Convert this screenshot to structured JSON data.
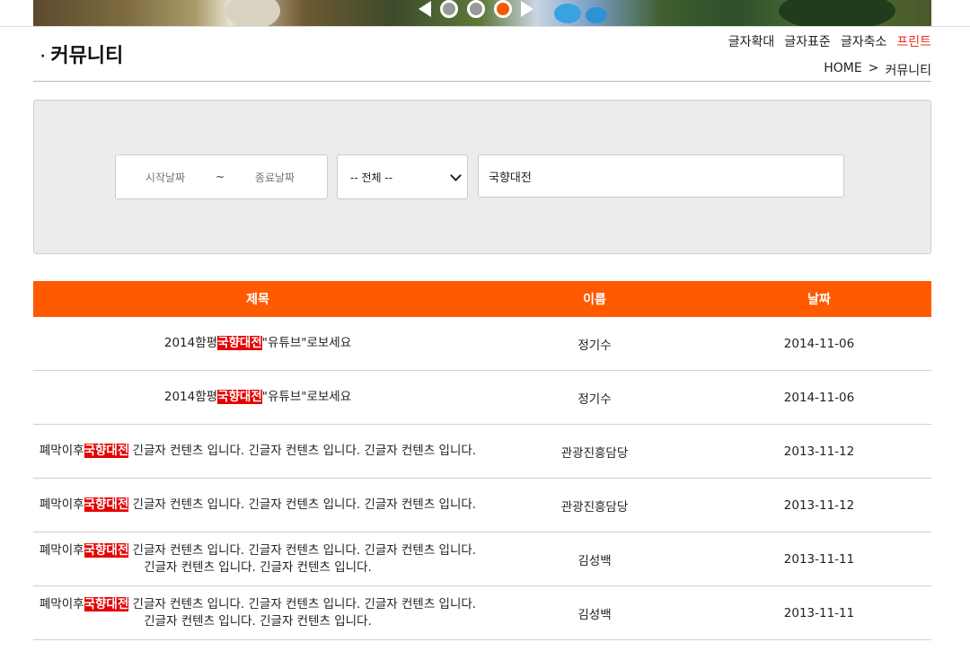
{
  "banner": {
    "slider": {
      "prev": "previous-slide",
      "next": "next-slide",
      "dots": 3,
      "active_dot": 3
    }
  },
  "header": {
    "title": "커뮤니티",
    "bullet": "·",
    "font_tools": {
      "enlarge": "글자확대",
      "normal": "글자표준",
      "shrink": "글자축소",
      "print": "프린트"
    },
    "breadcrumb": {
      "home": "HOME",
      "sep": ">",
      "current": "커뮤니티"
    }
  },
  "search": {
    "start_placeholder": "시작날짜",
    "tilde": "~",
    "end_placeholder": "종료날짜",
    "category_value": "-- 전체 --",
    "keyword_value": "국향대전"
  },
  "table": {
    "headers": {
      "title": "제목",
      "name": "이름",
      "date": "날짜"
    },
    "rows": [
      {
        "pre": "2014함평",
        "hl": "국향대전",
        "post": "\"유튜브\"로보세요",
        "name": "정기수",
        "date": "2014-11-06"
      },
      {
        "pre": "2014함평",
        "hl": "국향대전",
        "post": "\"유튜브\"로보세요",
        "name": "정기수",
        "date": "2014-11-06"
      },
      {
        "pre": "폐막이후",
        "hl": "국향대전",
        "post": " 긴글자 컨텐츠 입니다. 긴글자 컨텐츠 입니다. 긴글자 컨텐츠 입니다.",
        "name": "관광진흥담당",
        "date": "2013-11-12"
      },
      {
        "pre": "폐막이후",
        "hl": "국향대전",
        "post": " 긴글자 컨텐츠 입니다. 긴글자 컨텐츠 입니다. 긴글자 컨텐츠 입니다.",
        "name": "관광진흥담당",
        "date": "2013-11-12"
      },
      {
        "pre": "폐막이후",
        "hl": "국향대전",
        "post": " 긴글자 컨텐츠 입니다. 긴글자 컨텐츠 입니다. 긴글자 컨텐츠 입니다. 긴글자 컨텐츠 입니다. 긴글자 컨텐츠 입니다.",
        "name": "김성백",
        "date": "2013-11-11"
      },
      {
        "pre": "폐막이후",
        "hl": "국향대전",
        "post": " 긴글자 컨텐츠 입니다. 긴글자 컨텐츠 입니다. 긴글자 컨텐츠 입니다. 긴글자 컨텐츠 입니다. 긴글자 컨텐츠 입니다.",
        "name": "김성백",
        "date": "2013-11-11"
      }
    ]
  },
  "colors": {
    "accent": "#ff5a00",
    "highlight": "#e60000",
    "print": "#e8311c"
  }
}
